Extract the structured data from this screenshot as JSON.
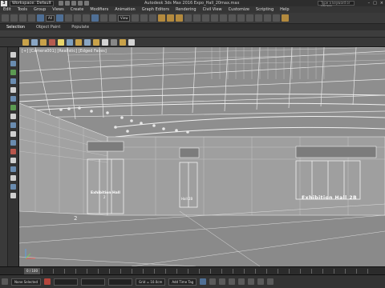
{
  "title_bar": {
    "app_logo": "3",
    "workspace": "Workspace: Default",
    "window_title": "Autodesk 3ds Max 2016    Expo_Hall_20max.max",
    "search_placeholder": "Type a keyword or phrase",
    "window_controls": [
      "–",
      "□",
      "×"
    ]
  },
  "menu": [
    "Edit",
    "Tools",
    "Group",
    "Views",
    "Create",
    "Modifiers",
    "Animation",
    "Graph Editors",
    "Rendering",
    "Civil View",
    "Customize",
    "Scripting",
    "Help"
  ],
  "toolbar": {
    "selection_filter": "All",
    "view_dropdown": "View"
  },
  "ribbon_tabs": [
    "Selection",
    "Object Paint",
    "Populate"
  ],
  "viewport": {
    "label": "[+] [Camera001] [Realistic] [Edged Faces]",
    "sign_left": "Exhibition Hall",
    "sign_left_number": "2",
    "sign_right": "Exhibition Hall 2B",
    "door_left_number": "2",
    "door_mid_label": "Hall 2B"
  },
  "timeline": {
    "frame": "0 / 100"
  },
  "statusbar": {
    "selection": "None Selected",
    "x_value": "",
    "grid": "Grid = 10.0cm",
    "time_tag": "Add Time Tag"
  },
  "colors": {
    "viewport_bg": "#9a9a9a",
    "wire": "#e8e8e8",
    "ui_dark": "#333333"
  }
}
